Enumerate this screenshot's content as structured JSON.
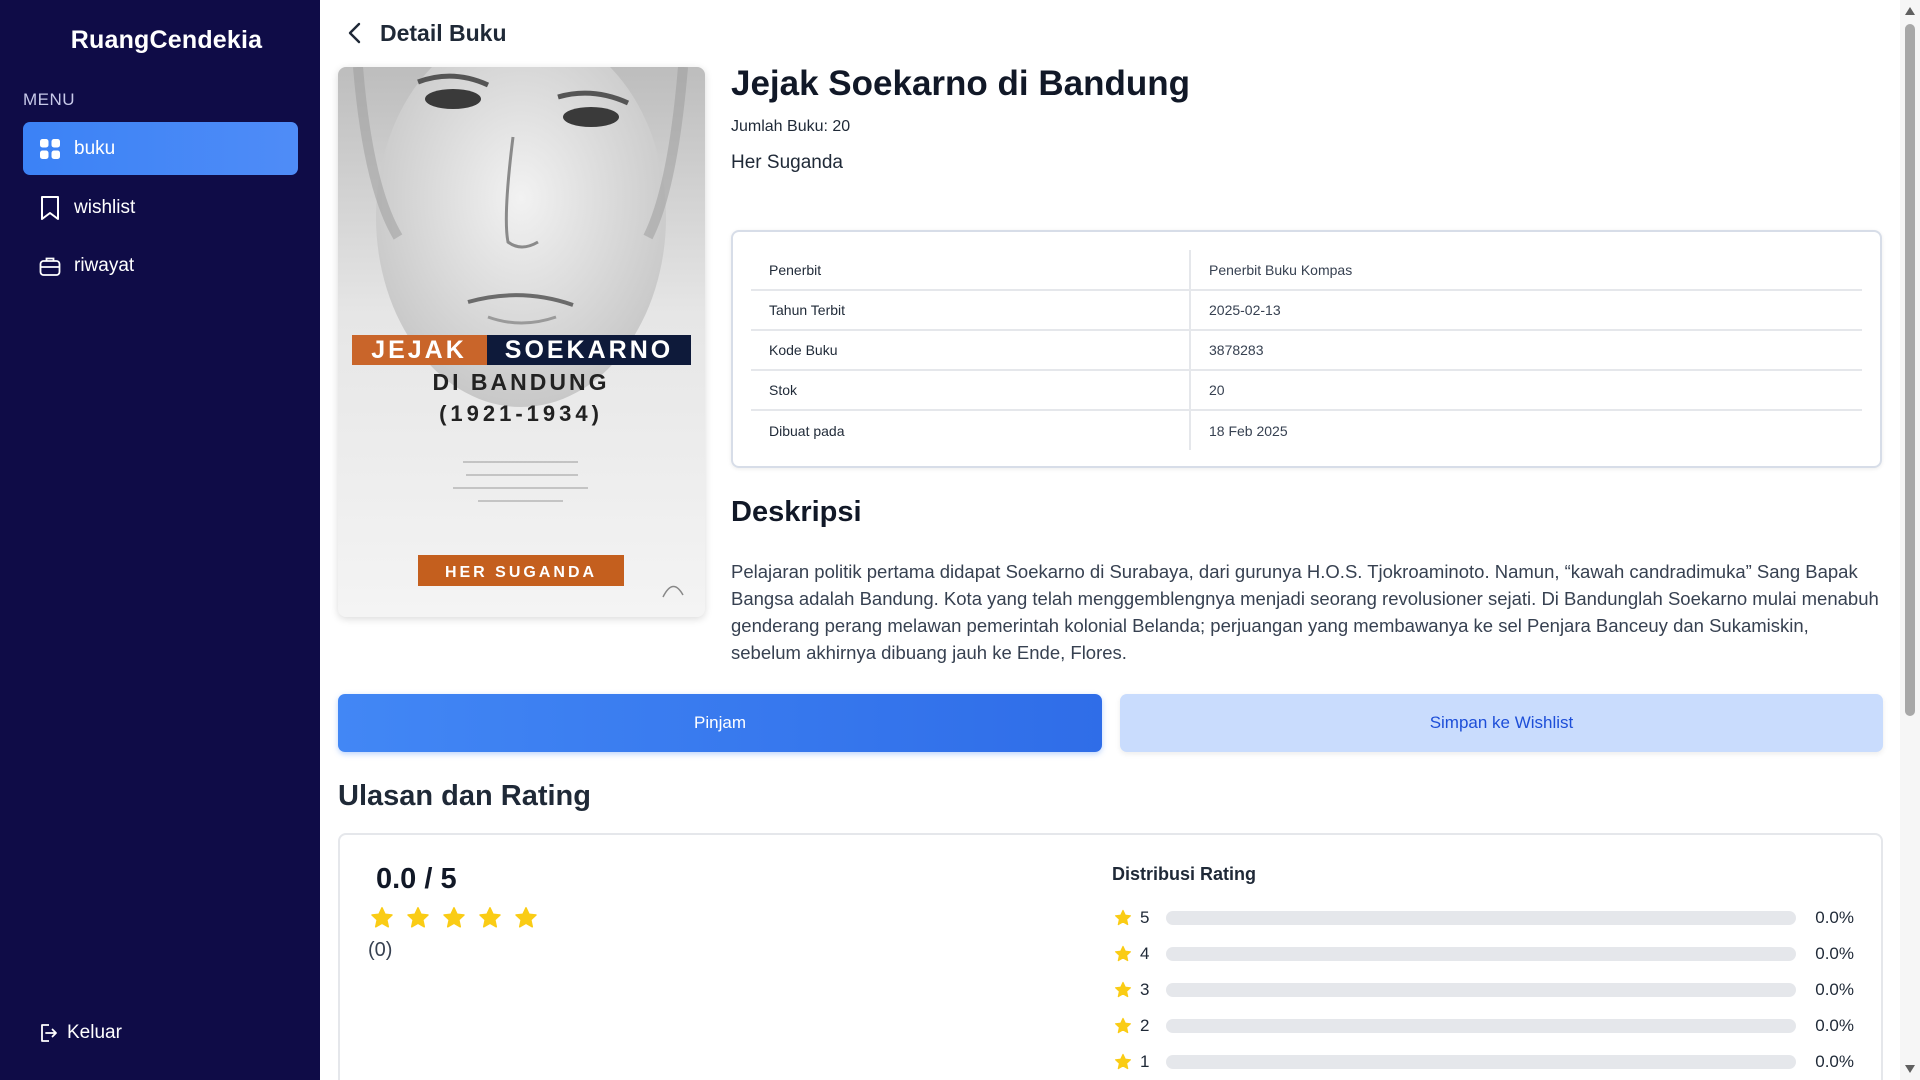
{
  "app": {
    "brand": "RuangCendekia"
  },
  "sidebar": {
    "menu_label": "MENU",
    "items": [
      {
        "label": "buku",
        "icon": "grid-icon",
        "active": true
      },
      {
        "label": "wishlist",
        "icon": "bookmark-icon",
        "active": false
      },
      {
        "label": "riwayat",
        "icon": "briefcase-icon",
        "active": false
      }
    ],
    "logout_label": "Keluar"
  },
  "header": {
    "title": "Detail Buku"
  },
  "cover": {
    "title_line1_a": "JEJAK",
    "title_line1_b": "SOEKARNO",
    "title_line2": "DI BANDUNG",
    "title_line3": "(1921-1934)",
    "author_badge": "HER SUGANDA"
  },
  "book": {
    "title": "Jejak Soekarno di Bandung",
    "count_text": "Jumlah Buku: 20",
    "author": "Her Suganda"
  },
  "details": [
    {
      "label": "Penerbit",
      "value": "Penerbit Buku Kompas"
    },
    {
      "label": "Tahun Terbit",
      "value": "2025-02-13"
    },
    {
      "label": "Kode Buku",
      "value": "3878283"
    },
    {
      "label": "Stok",
      "value": "20"
    },
    {
      "label": "Dibuat pada",
      "value": "18 Feb 2025"
    }
  ],
  "description": {
    "title": "Deskripsi",
    "text": "Pelajaran politik pertama didapat Soekarno di Surabaya, dari gurunya H.O.S. Tjokroaminoto. Namun, “kawah candradimuka” Sang Bapak Bangsa adalah Bandung. Kota yang telah menggemblengnya menjadi seorang revolusioner sejati. Di Bandunglah Soekarno mulai menabuh genderang perang melawan pemerintah kolonial Belanda; perjuangan yang membawanya ke sel Penjara Banceuy dan Sukamiskin, sebelum akhirnya dibuang jauh ke Ende, Flores."
  },
  "actions": {
    "borrow_label": "Pinjam",
    "wishlist_label": "Simpan ke Wishlist"
  },
  "reviews": {
    "title": "Ulasan dan Rating",
    "score": "0.0 / 5",
    "count": "(0)",
    "distribution_title": "Distribusi Rating",
    "distribution": [
      {
        "stars": "5",
        "percent": "0.0%",
        "fraction": 0
      },
      {
        "stars": "4",
        "percent": "0.0%",
        "fraction": 0
      },
      {
        "stars": "3",
        "percent": "0.0%",
        "fraction": 0
      },
      {
        "stars": "2",
        "percent": "0.0%",
        "fraction": 0
      },
      {
        "stars": "1",
        "percent": "0.0%",
        "fraction": 0
      }
    ]
  },
  "colors": {
    "sidebar_bg": "#0f0c47",
    "accent": "#3b82f6",
    "star": "#facc15",
    "secondary_button_bg": "#c9dcfd"
  }
}
